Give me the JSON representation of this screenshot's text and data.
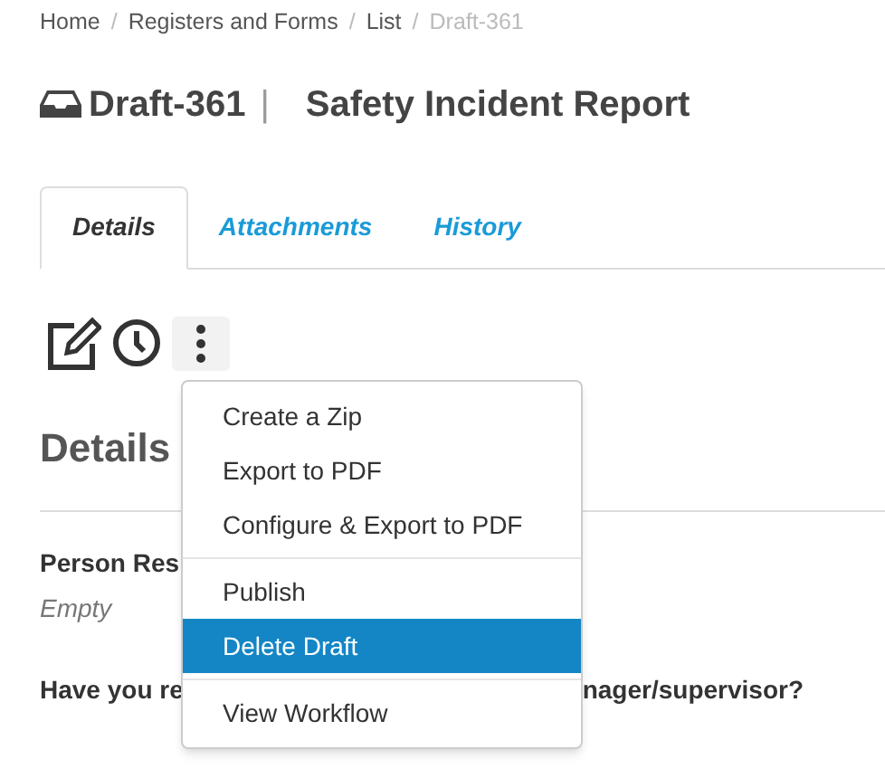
{
  "breadcrumb": [
    {
      "label": "Home",
      "current": false
    },
    {
      "label": "Registers and Forms",
      "current": false
    },
    {
      "label": "List",
      "current": false
    },
    {
      "label": "Draft-361",
      "current": true
    }
  ],
  "breadcrumb_separator": "/",
  "title": {
    "id": "Draft-361",
    "separator": "|",
    "name": "Safety Incident Report"
  },
  "tabs": [
    {
      "label": "Details",
      "selected": true
    },
    {
      "label": "Attachments",
      "selected": false
    },
    {
      "label": "History",
      "selected": false
    }
  ],
  "menu": {
    "groups": [
      [
        {
          "label": "Create a Zip",
          "selected": false
        },
        {
          "label": "Export to PDF",
          "selected": false
        },
        {
          "label": "Configure & Export to PDF",
          "selected": false
        }
      ],
      [
        {
          "label": "Publish",
          "selected": false
        },
        {
          "label": "Delete Draft",
          "selected": true
        }
      ],
      [
        {
          "label": "View Workflow",
          "selected": false
        }
      ]
    ]
  },
  "section_heading": "Details",
  "fields": [
    {
      "label": "Person Res",
      "value": "Empty"
    }
  ],
  "question": {
    "left": "Have you re",
    "right": "nager/supervisor?"
  }
}
